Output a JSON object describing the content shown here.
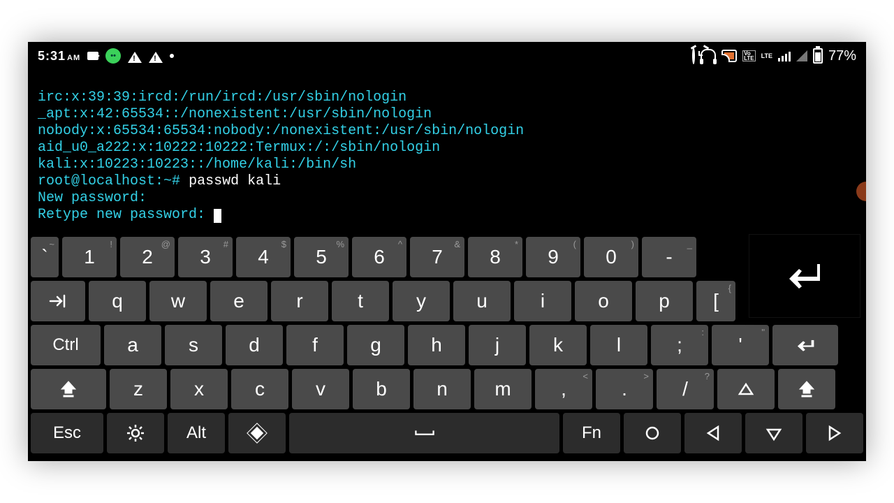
{
  "statusbar": {
    "time": "5:31",
    "ampm": "AM",
    "battery_pct": "77%",
    "lte": "LTE",
    "volte": "Vo\nLTE"
  },
  "terminal": {
    "line1": "irc:x:39:39:ircd:/run/ircd:/usr/sbin/nologin",
    "line2": "_apt:x:42:65534::/nonexistent:/usr/sbin/nologin",
    "line3": "nobody:x:65534:65534:nobody:/nonexistent:/usr/sbin/nologin",
    "line4": "aid_u0_a222:x:10222:10222:Termux:/:/sbin/nologin",
    "line5": "kali:x:10223:10223::/home/kali:/bin/sh",
    "prompt": "root@localhost:~#",
    "command": "passwd kali",
    "line7": "New password:",
    "line8": "Retype new password:"
  },
  "keys": {
    "tilde": "`",
    "tilde_s": "~",
    "n1": "1",
    "n1s": "!",
    "n2": "2",
    "n2s": "@",
    "n3": "3",
    "n3s": "#",
    "n4": "4",
    "n4s": "$",
    "n5": "5",
    "n5s": "%",
    "n6": "6",
    "n6s": "^",
    "n7": "7",
    "n7s": "&",
    "n8": "8",
    "n8s": "*",
    "n9": "9",
    "n9s": "(",
    "n0": "0",
    "n0s": ")",
    "dash": "-",
    "dash_s": "_",
    "q": "q",
    "w": "w",
    "e": "e",
    "r": "r",
    "t": "t",
    "y": "y",
    "u": "u",
    "i": "i",
    "o": "o",
    "p": "p",
    "lb": "[",
    "lb_s": "{",
    "ctrl": "Ctrl",
    "a": "a",
    "s": "s",
    "d": "d",
    "f": "f",
    "g": "g",
    "h": "h",
    "j": "j",
    "k": "k",
    "l": "l",
    "semi": ";",
    "semi_s": ":",
    "quote": "'",
    "quote_s": "\"",
    "z": "z",
    "x": "x",
    "c": "c",
    "v": "v",
    "b": "b",
    "n": "n",
    "m": "m",
    "comma": ",",
    "comma_s": "<",
    "period": ".",
    "period_s": ">",
    "slash": "/",
    "slash_s": "?",
    "esc": "Esc",
    "alt": "Alt",
    "fn": "Fn",
    "space": "⎵"
  }
}
